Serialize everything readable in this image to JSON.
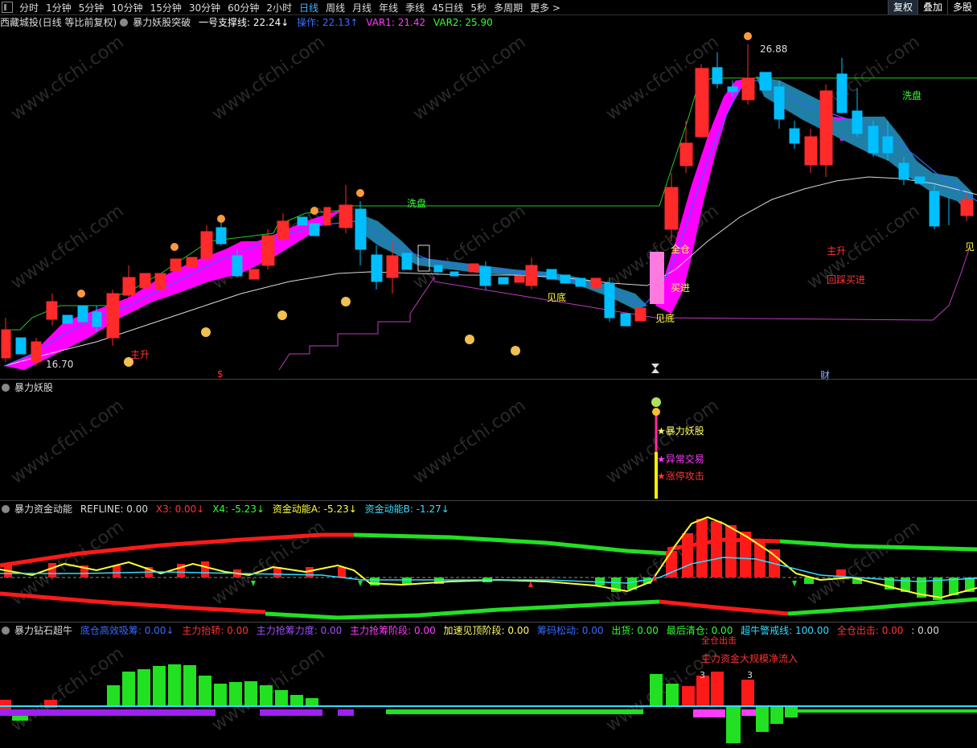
{
  "toolbar": {
    "periods": [
      "分时",
      "1分钟",
      "5分钟",
      "10分钟",
      "15分钟",
      "30分钟",
      "60分钟",
      "2小时",
      "日线",
      "周线",
      "月线",
      "年线",
      "季线",
      "45日线",
      "5秒",
      "多周期",
      "更多 >"
    ],
    "active": "日线",
    "right": [
      "复权",
      "叠加",
      "多股"
    ]
  },
  "main": {
    "title": "西藏城投(日线 等比前复权)",
    "indicator": "暴力妖股突破",
    "support_label": "一号支撑线: 22.24↓",
    "operate_label": "操作: 22.13↑",
    "var1_label": "VAR1: 21.42",
    "var2_label": "VAR2: 25.90",
    "high_price": "26.88",
    "low_price": "16.70",
    "texts": {
      "xipan1": "洗盘",
      "xipan2": "洗盘",
      "zhusheng1": "主升",
      "zhusheng2": "主升",
      "huicai": "回踩买进",
      "jiandi1": "见底",
      "jiandi2": "见底",
      "quancang": "全仓",
      "mairu": "买进",
      "cai": "财",
      "jian": "见",
      "mark": "$"
    }
  },
  "panel2": {
    "title": "暴力妖股",
    "labels": [
      "★暴力妖股",
      "★异常交易",
      "★涨停攻击"
    ]
  },
  "panel3": {
    "title": "暴力资金动能",
    "refline": "REFLINE: 0.00",
    "x3": "X3: 0.00↓",
    "x4": "X4: -5.23↓",
    "a": "资金动能A: -5.23↓",
    "b": "资金动能B: -1.27↓"
  },
  "panel4": {
    "title": "暴力钻石超牛",
    "items": [
      "底仓高效吸筹: 0.00↓",
      "主力抬轿: 0.00",
      "主力抢筹力度: 0.00",
      "主力抢筹阶段: 0.00",
      "加速见顶阶段: 0.00",
      "筹码松动: 0.00",
      "出货: 0.00",
      "最后清仓: 0.00",
      "超牛警戒线: 100.00",
      "全仓出击: 0.00",
      ": 0.00"
    ],
    "notes": [
      "全仓出击",
      "主力资金大规模净流入",
      "3",
      "3"
    ]
  },
  "colors": {
    "up": "#ff2a2a",
    "down": "#00bfff",
    "magenta": "#ff00ff",
    "teal": "#1f7fa6",
    "green": "#22e022",
    "yellow": "#ffff33",
    "white": "#d8d8d8"
  }
}
